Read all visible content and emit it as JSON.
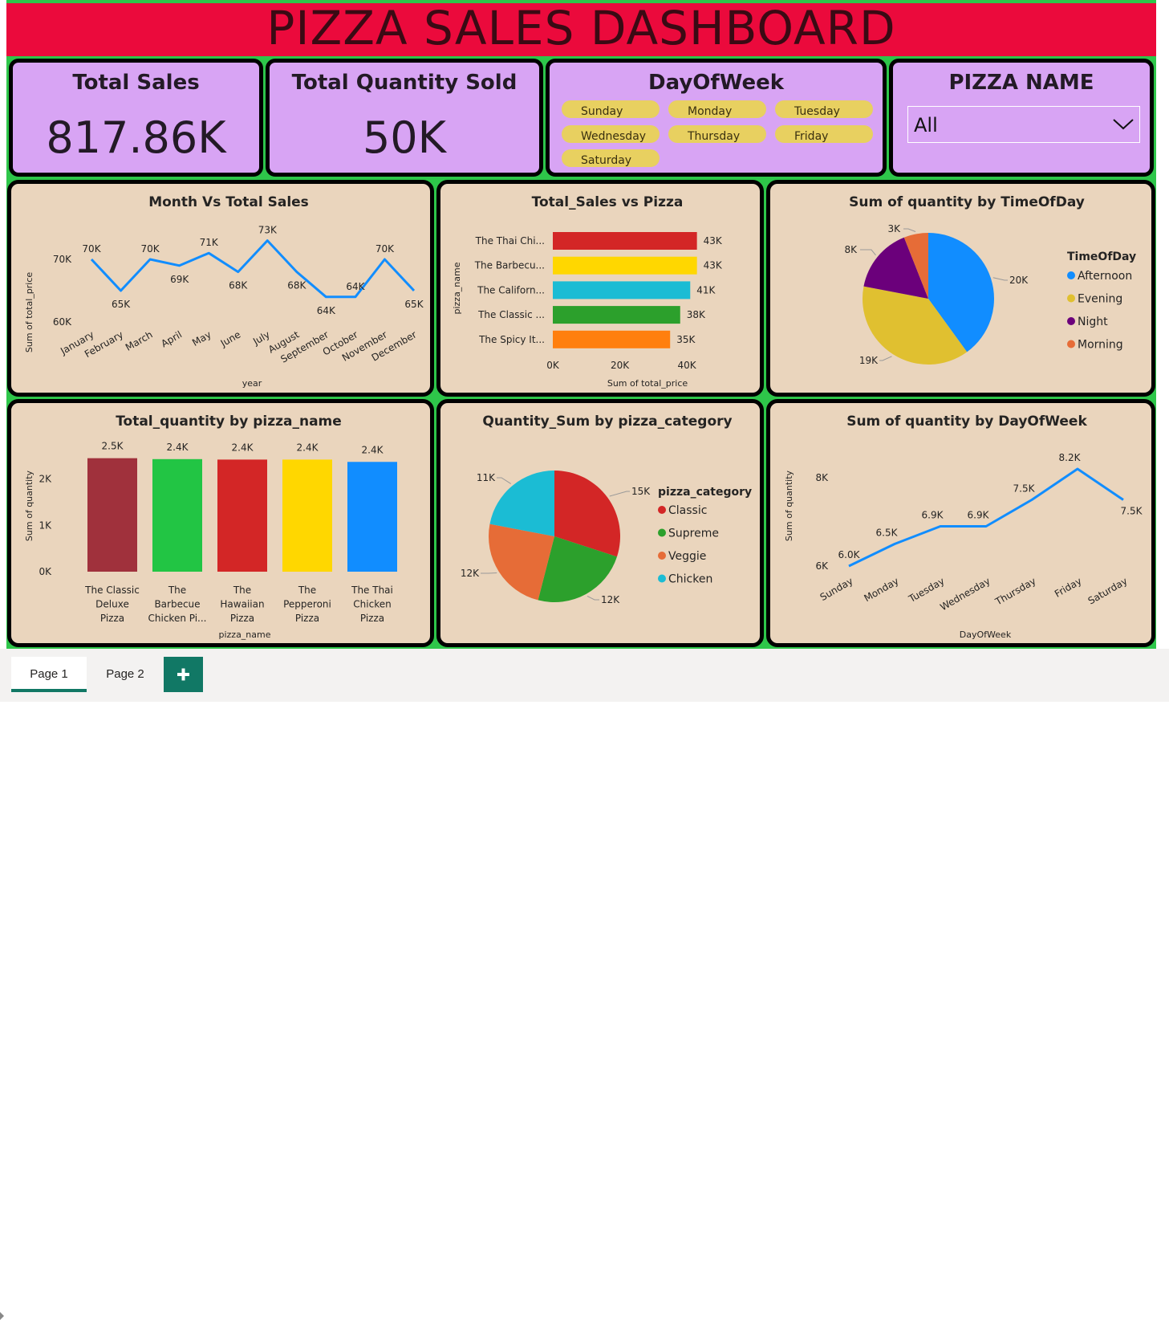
{
  "title": "PIZZA SALES DASHBOARD",
  "kpis": {
    "total_sales": {
      "label": "Total Sales",
      "value": "817.86K"
    },
    "total_quantity": {
      "label": "Total Quantity Sold",
      "value": "50K"
    }
  },
  "day_slicer": {
    "label": "DayOfWeek",
    "options": [
      "Sunday",
      "Monday",
      "Tuesday",
      "Wednesday",
      "Thursday",
      "Friday",
      "Saturday"
    ]
  },
  "pizza_slicer": {
    "label": "PIZZA NAME",
    "selected": "All"
  },
  "colors": {
    "title_bar": "#eb0a3c",
    "background": "#2ec64a",
    "card": "#d8a4f4",
    "panel": "#ead5bd",
    "line": "#118dff",
    "pill": "#e8d060",
    "tab_accent": "#117865"
  },
  "icons": [
    "chevron-down-icon",
    "plus-icon"
  ],
  "tabs": {
    "page1": "Page 1",
    "page2": "Page 2",
    "add": "+"
  },
  "chart_data": [
    {
      "type": "line",
      "title": "Month Vs Total Sales",
      "xlabel": "year",
      "ylabel": "Sum of total_price",
      "x": [
        "January",
        "February",
        "March",
        "April",
        "May",
        "June",
        "July",
        "August",
        "September",
        "October",
        "November",
        "December"
      ],
      "series": [
        {
          "values": [
            70,
            65,
            70,
            69,
            71,
            68,
            73,
            68,
            64,
            64,
            70,
            65
          ]
        }
      ],
      "data_labels": [
        "70K",
        "65K",
        "70K",
        "69K",
        "71K",
        "68K",
        "73K",
        "68K",
        "64K",
        "64K",
        "70K",
        "65K"
      ],
      "y_ticks": [
        "60K",
        "70K"
      ],
      "ylim": [
        60,
        75
      ],
      "grid": false
    },
    {
      "type": "bar",
      "orientation": "horizontal",
      "title": "Total_Sales vs Pizza",
      "xlabel": "Sum of total_price",
      "ylabel": "pizza_name",
      "categories": [
        "The Thai Chi...",
        "The Barbecu...",
        "The Californ...",
        "The Classic ...",
        "The Spicy It..."
      ],
      "values": [
        43,
        43,
        41,
        38,
        35
      ],
      "data_labels": [
        "43K",
        "43K",
        "41K",
        "38K",
        "35K"
      ],
      "bar_colors": [
        "#d32626",
        "#ffd700",
        "#1bbcd4",
        "#2ca02c",
        "#ff7f0e"
      ],
      "x_ticks": [
        "0K",
        "20K",
        "40K"
      ],
      "xlim": [
        0,
        45
      ]
    },
    {
      "type": "pie",
      "title": "Sum of quantity by TimeOfDay",
      "legend_title": "TimeOfDay",
      "legend_position": "right",
      "labels": [
        "Afternoon",
        "Evening",
        "Night",
        "Morning"
      ],
      "values": [
        20,
        19,
        8,
        3
      ],
      "data_labels": [
        "20K",
        "19K",
        "8K",
        "3K"
      ],
      "colors": [
        "#118dff",
        "#e0c030",
        "#6b007b",
        "#e66c37"
      ]
    },
    {
      "type": "bar",
      "title": "Total_quantity by pizza_name",
      "xlabel": "pizza_name",
      "ylabel": "Sum of quantity",
      "categories": [
        "The Classic Deluxe Pizza",
        "The Barbecue Chicken Pi...",
        "The Hawaiian Pizza",
        "The Pepperoni Pizza",
        "The Thai Chicken Pizza"
      ],
      "category_lines": [
        [
          "The Classic",
          "Deluxe",
          "Pizza"
        ],
        [
          "The",
          "Barbecue",
          "Chicken Pi..."
        ],
        [
          "The",
          "Hawaiian",
          "Pizza"
        ],
        [
          "The",
          "Pepperoni",
          "Pizza"
        ],
        [
          "The Thai",
          "Chicken",
          "Pizza"
        ]
      ],
      "values": [
        2.45,
        2.43,
        2.42,
        2.42,
        2.37
      ],
      "data_labels": [
        "2.5K",
        "2.4K",
        "2.4K",
        "2.4K",
        "2.4K"
      ],
      "bar_colors": [
        "#a0313c",
        "#22c544",
        "#d32626",
        "#ffd700",
        "#118dff"
      ],
      "y_ticks": [
        "0K",
        "1K",
        "2K"
      ],
      "ylim": [
        0,
        2.6
      ]
    },
    {
      "type": "pie",
      "title": "Quantity_Sum by pizza_category",
      "legend_title": "pizza_category",
      "legend_position": "right",
      "labels": [
        "Classic",
        "Supreme",
        "Veggie",
        "Chicken"
      ],
      "values": [
        15,
        12,
        12,
        11
      ],
      "data_labels": [
        "15K",
        "12K",
        "12K",
        "11K"
      ],
      "colors": [
        "#d32626",
        "#2ca02c",
        "#e66c37",
        "#1bbcd4"
      ]
    },
    {
      "type": "line",
      "title": "Sum of quantity by DayOfWeek",
      "xlabel": "DayOfWeek",
      "ylabel": "Sum of quantity",
      "x": [
        "Sunday",
        "Monday",
        "Tuesday",
        "Wednesday",
        "Thursday",
        "Friday",
        "Saturday"
      ],
      "series": [
        {
          "values": [
            6.0,
            6.5,
            6.9,
            6.9,
            7.5,
            8.2,
            7.5
          ]
        }
      ],
      "data_labels": [
        "6.0K",
        "6.5K",
        "6.9K",
        "6.9K",
        "7.5K",
        "8.2K",
        "7.5K"
      ],
      "y_ticks": [
        "6K",
        "8K"
      ],
      "ylim": [
        5.6,
        8.6
      ],
      "grid": false
    }
  ]
}
